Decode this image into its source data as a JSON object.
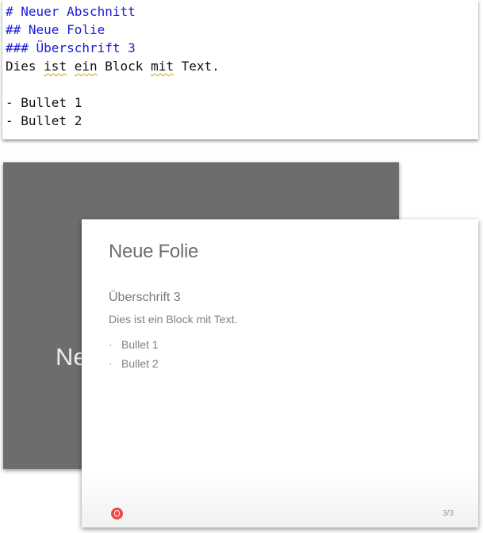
{
  "editor": {
    "lines": [
      {
        "text": "# Neuer Abschnitt",
        "kind": "heading"
      },
      {
        "text": "## Neue Folie",
        "kind": "heading"
      },
      {
        "text": "### Überschrift 3",
        "kind": "heading"
      },
      {
        "text": "Dies ist ein Block mit Text.",
        "kind": "text"
      },
      {
        "text": "",
        "kind": "blank"
      },
      {
        "text": "- Bullet 1",
        "kind": "text"
      },
      {
        "text": "- Bullet 2",
        "kind": "text"
      }
    ]
  },
  "slide_back": {
    "section_title": "Ne"
  },
  "slide_front": {
    "title": "Neue Folie",
    "heading3": "Überschrift 3",
    "text": "Dies ist ein Block mit Text.",
    "bullets": [
      "Bullet 1",
      "Bullet 2"
    ],
    "logo_icon": "logo-icon",
    "page_number": "3/3"
  },
  "colors": {
    "heading": "#1a1adb",
    "slide_back_bg": "#6d6d6d",
    "logo": "#ec4a4a"
  }
}
